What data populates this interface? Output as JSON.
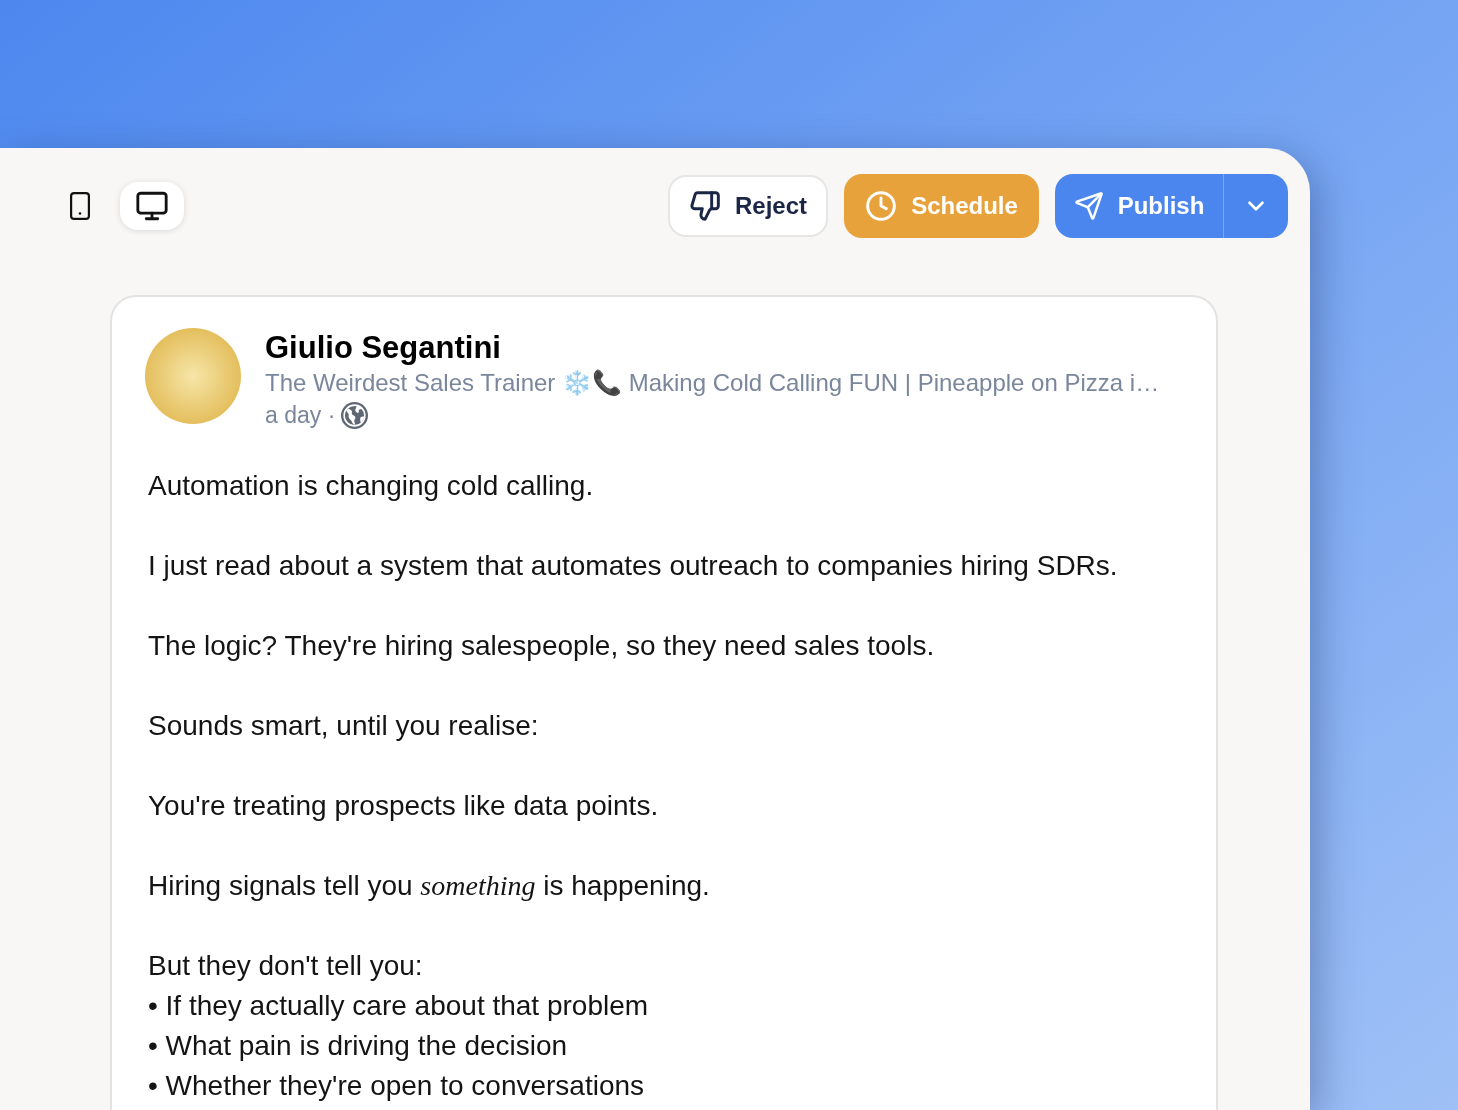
{
  "view_toggle": [
    {
      "kind": "mobile",
      "selected": false
    },
    {
      "kind": "desktop",
      "selected": true
    }
  ],
  "actions": [
    {
      "kind": "reject",
      "label": "Reject"
    },
    {
      "kind": "schedule",
      "label": "Schedule"
    },
    {
      "kind": "publish",
      "label": "Publish",
      "has_menu": true
    }
  ],
  "post": {
    "author": {
      "name": "Giulio Segantini",
      "headline": "The Weirdest Sales Trainer ❄️📞 Making Cold Calling FUN | Pineapple on Pizza i…",
      "time": "a day ·"
    },
    "body": [
      {
        "lines": [
          "Automation is changing cold calling."
        ]
      },
      {
        "lines": [
          "I just read about a system that automates outreach to companies hiring SDRs."
        ]
      },
      {
        "lines": [
          "The logic? They're hiring salespeople, so they need sales tools."
        ]
      },
      {
        "lines": [
          "Sounds smart, until you realise:"
        ]
      },
      {
        "lines": [
          "You're treating prospects like data points."
        ]
      },
      {
        "lines": [
          "Hiring signals tell you *something* is happening."
        ]
      },
      {
        "lines": [
          "But they don't tell you:",
          "• If they actually care about that problem",
          "• What pain is driving the decision",
          "• Whether they're open to conversations"
        ]
      }
    ]
  }
}
